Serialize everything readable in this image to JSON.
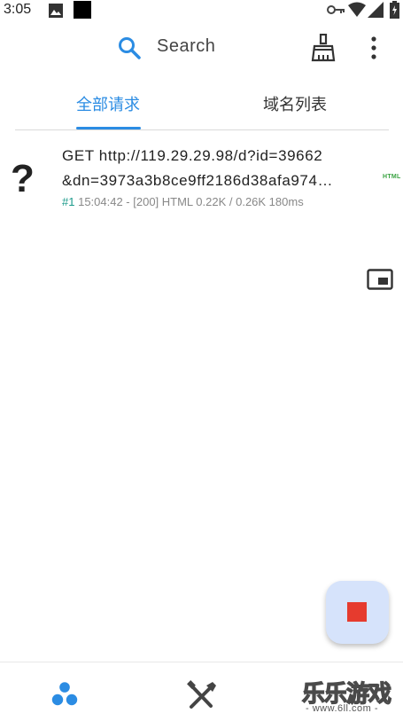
{
  "status_bar": {
    "time": "3:05",
    "icons": [
      "image-icon",
      "black-square-icon",
      "vpn-key-icon",
      "wifi-icon",
      "signal-icon",
      "battery-charging-icon"
    ]
  },
  "search_bar": {
    "icon": "search-icon",
    "label": "Search",
    "actions": [
      "broom-icon",
      "more-vert-icon"
    ]
  },
  "tabs": [
    {
      "label": "全部请求",
      "selected": true
    },
    {
      "label": "域名列表",
      "selected": false
    }
  ],
  "requests": [
    {
      "type_icon": "question-icon",
      "line1": "GET http://119.29.29.98/d?id=39662",
      "line2": "&dn=3973a3b8ce9ff2186d38afa974…",
      "index": "#1",
      "details": "15:04:42 - [200] HTML 0.22K / 0.26K  180ms",
      "badge": "HTML"
    }
  ],
  "pip_icon": "picture-in-picture-icon",
  "fab": {
    "icon": "stop-icon"
  },
  "bottom_nav": [
    {
      "icon": "requests-dots-icon",
      "selected": true
    },
    {
      "icon": "tools-icon",
      "selected": false
    }
  ],
  "watermark": {
    "text": "乐乐游戏",
    "url": "- www.6ll.com -"
  },
  "colors": {
    "accent": "#2b8ce3",
    "stop": "#e63b2e",
    "fab_bg": "#d6e3fb",
    "index": "#1a9a8a",
    "badge": "#3aa343"
  }
}
